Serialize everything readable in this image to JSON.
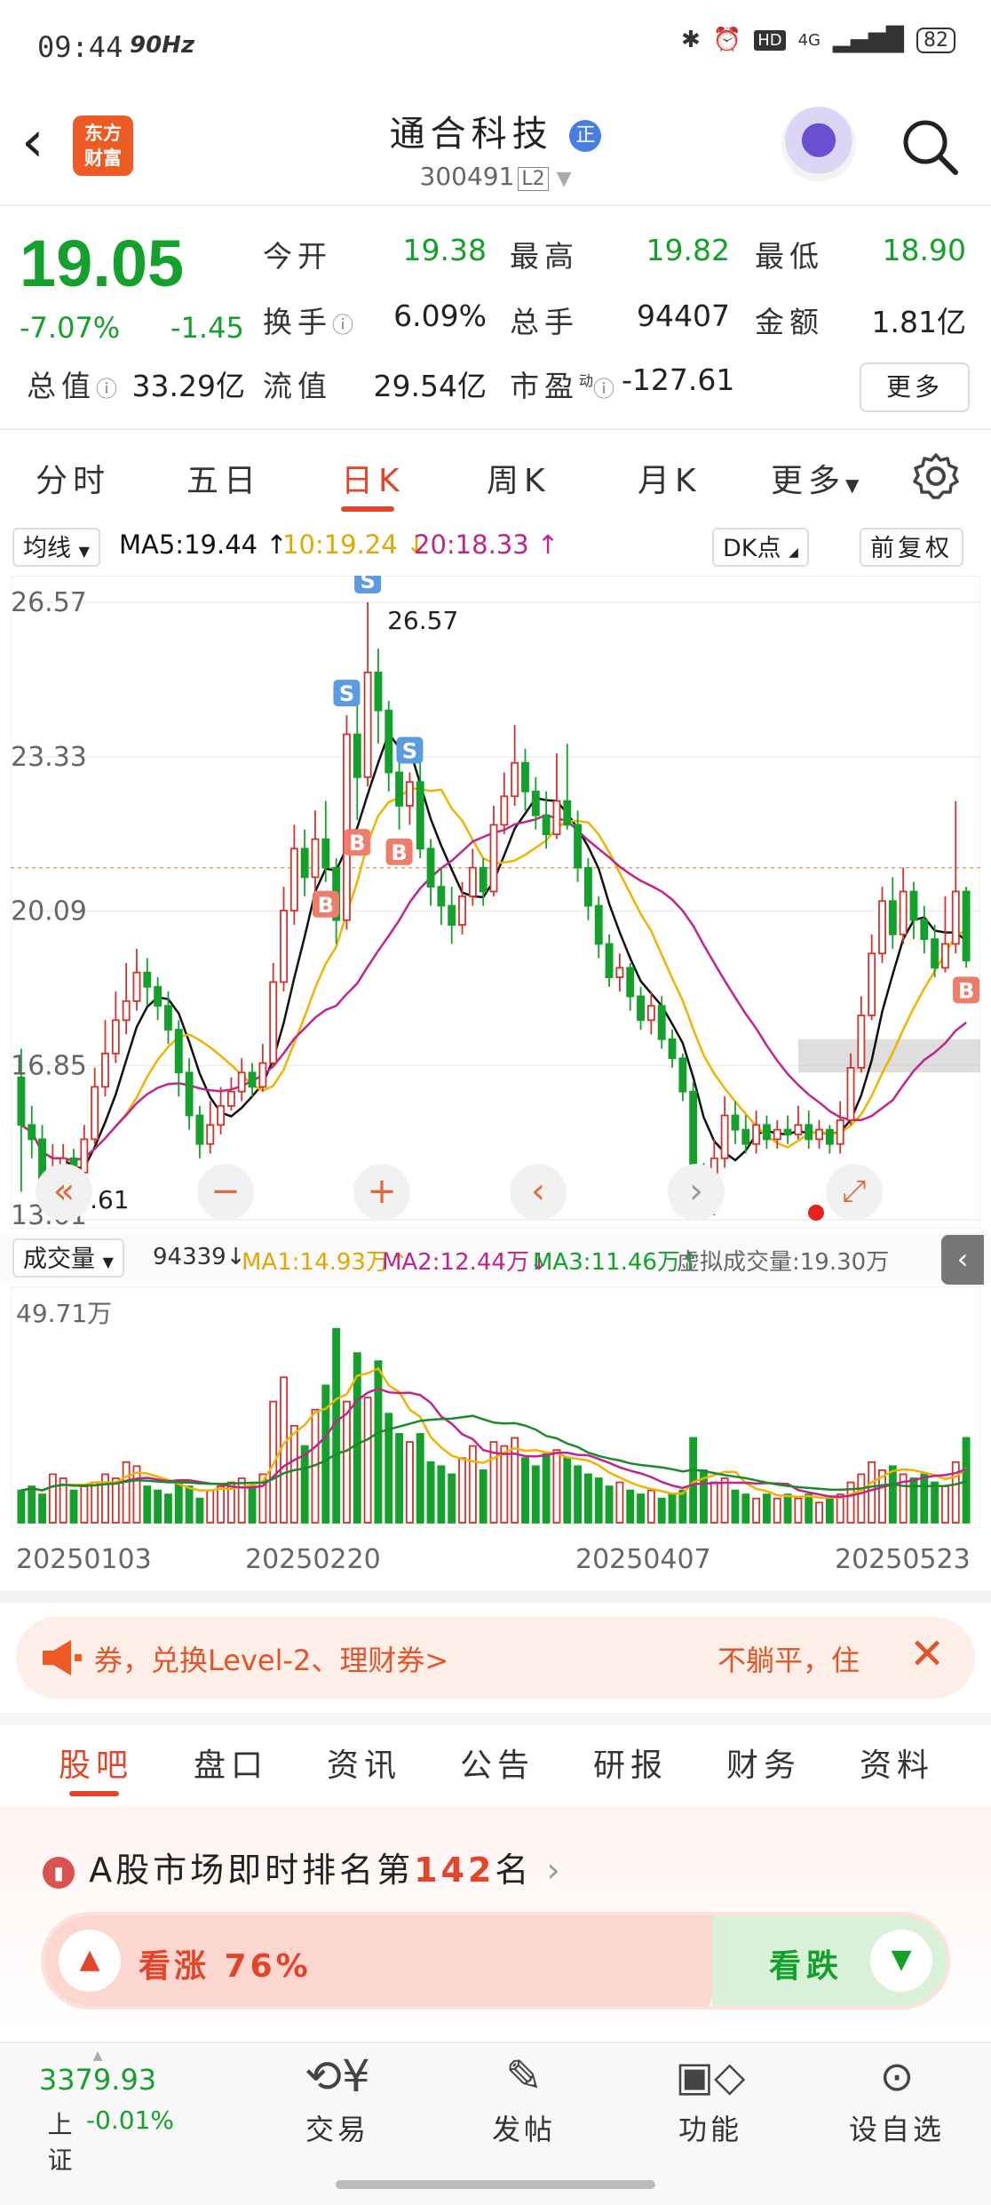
{
  "status_bar": {
    "time": "09:44",
    "refresh": "90Hz",
    "network": "4G",
    "battery": "82"
  },
  "header": {
    "title": "通合科技",
    "badge": "正",
    "code": "300491",
    "level": "L2",
    "logo_text_1": "东方",
    "logo_text_2": "财富"
  },
  "quote": {
    "price": "19.05",
    "change_pct": "-7.07%",
    "change": "-1.45",
    "open_label": "今开",
    "open": "19.38",
    "high_label": "最高",
    "high": "19.82",
    "low_label": "最低",
    "low": "18.90",
    "turnover_label": "换手",
    "turnover": "6.09%",
    "volume_label": "总手",
    "volume": "94407",
    "amount_label": "金额",
    "amount": "1.81亿",
    "mktcap_label": "总值",
    "mktcap": "33.29亿",
    "float_label": "流值",
    "float": "29.54亿",
    "pe_label": "市盈",
    "pe_sup": "动",
    "pe": "-127.61",
    "more": "更多"
  },
  "chart_tabs": [
    "分时",
    "五日",
    "日K",
    "周K",
    "月K",
    "更多"
  ],
  "ma_legend": {
    "selector": "均线",
    "ma5": "MA5:19.44",
    "ma10": "10:19.24",
    "ma20": "20:18.33",
    "dk": "DK点",
    "adjust": "前复权"
  },
  "colors": {
    "up": "#d0342c",
    "down": "#14a12b",
    "ma5": "#111111",
    "ma10": "#f0b400",
    "ma20": "#c0258b",
    "accent": "#e3452a"
  },
  "chart_data": {
    "type": "candlestick",
    "y_ticks": [
      "26.57",
      "23.33",
      "20.09",
      "16.85",
      "13.61"
    ],
    "ylim": [
      13.61,
      26.57
    ],
    "max_label": "26.57",
    "min_label": "13.61",
    "dates": [
      "20250103",
      "20250220",
      "20250407",
      "20250523"
    ],
    "candles": [
      [
        16.6,
        15.6,
        17.2,
        14.2
      ],
      [
        15.6,
        15.3,
        16.0,
        14.9
      ],
      [
        15.3,
        14.2,
        15.6,
        14.0
      ],
      [
        14.2,
        14.5,
        15.2,
        13.8
      ],
      [
        14.5,
        14.9,
        15.2,
        14.3
      ],
      [
        14.9,
        14.6,
        15.1,
        14.4
      ],
      [
        14.6,
        15.3,
        15.6,
        14.5
      ],
      [
        15.3,
        16.4,
        16.8,
        15.2
      ],
      [
        16.4,
        17.1,
        17.8,
        16.2
      ],
      [
        17.1,
        17.8,
        18.4,
        16.9
      ],
      [
        17.8,
        18.2,
        19.0,
        17.5
      ],
      [
        18.2,
        18.8,
        19.3,
        18.0
      ],
      [
        18.8,
        18.5,
        19.1,
        18.1
      ],
      [
        18.5,
        18.1,
        18.7,
        17.8
      ],
      [
        18.1,
        17.6,
        18.4,
        17.3
      ],
      [
        17.6,
        16.7,
        17.8,
        16.2
      ],
      [
        16.7,
        15.8,
        17.0,
        15.5
      ],
      [
        15.8,
        15.2,
        16.0,
        14.9
      ],
      [
        15.2,
        15.6,
        16.1,
        15.0
      ],
      [
        15.6,
        16.0,
        16.4,
        15.4
      ],
      [
        16.0,
        16.3,
        16.6,
        15.9
      ],
      [
        16.3,
        16.7,
        17.0,
        16.1
      ],
      [
        16.7,
        16.4,
        16.9,
        16.2
      ],
      [
        16.4,
        16.9,
        17.3,
        16.3
      ],
      [
        16.9,
        18.6,
        19.0,
        16.8
      ],
      [
        18.6,
        20.1,
        20.6,
        18.4
      ],
      [
        20.1,
        21.4,
        21.9,
        19.8
      ],
      [
        21.4,
        20.8,
        21.8,
        20.4
      ],
      [
        20.8,
        21.6,
        22.2,
        20.5
      ],
      [
        21.6,
        21.0,
        22.4,
        20.7
      ],
      [
        21.0,
        19.9,
        21.2,
        19.4
      ],
      [
        19.9,
        23.8,
        24.2,
        19.7
      ],
      [
        23.8,
        22.9,
        24.8,
        22.0
      ],
      [
        22.9,
        25.1,
        26.57,
        22.7
      ],
      [
        25.1,
        24.3,
        25.6,
        23.6
      ],
      [
        24.3,
        23.0,
        24.5,
        22.6
      ],
      [
        23.0,
        22.3,
        23.3,
        21.8
      ],
      [
        22.3,
        22.8,
        23.0,
        21.9
      ],
      [
        22.8,
        21.4,
        23.3,
        21.2
      ],
      [
        21.4,
        20.6,
        21.6,
        20.2
      ],
      [
        20.6,
        20.2,
        21.0,
        19.8
      ],
      [
        20.2,
        19.8,
        20.6,
        19.4
      ],
      [
        19.8,
        20.4,
        20.7,
        19.6
      ],
      [
        20.4,
        21.0,
        21.4,
        20.2
      ],
      [
        21.0,
        20.5,
        21.2,
        20.2
      ],
      [
        20.5,
        21.9,
        22.3,
        20.4
      ],
      [
        21.9,
        22.5,
        23.0,
        21.7
      ],
      [
        22.5,
        23.2,
        24.0,
        22.3
      ],
      [
        23.2,
        22.6,
        23.5,
        22.2
      ],
      [
        22.6,
        22.1,
        22.9,
        21.8
      ],
      [
        22.1,
        21.7,
        22.6,
        21.4
      ],
      [
        21.7,
        22.4,
        23.4,
        21.6
      ],
      [
        22.4,
        21.9,
        23.6,
        21.8
      ],
      [
        21.9,
        21.0,
        22.2,
        20.7
      ],
      [
        21.0,
        20.2,
        21.2,
        19.9
      ],
      [
        20.2,
        19.4,
        20.4,
        19.1
      ],
      [
        19.4,
        18.7,
        19.6,
        18.5
      ],
      [
        18.7,
        18.9,
        19.2,
        18.4
      ],
      [
        18.9,
        18.3,
        19.0,
        18.0
      ],
      [
        18.3,
        17.8,
        18.5,
        17.6
      ],
      [
        17.8,
        18.1,
        18.4,
        17.5
      ],
      [
        18.1,
        17.4,
        18.3,
        17.2
      ],
      [
        17.4,
        17.0,
        17.6,
        16.8
      ],
      [
        17.0,
        16.3,
        17.1,
        16.1
      ],
      [
        16.3,
        14.2,
        16.5,
        14.0
      ],
      [
        14.2,
        13.9,
        14.8,
        13.61
      ],
      [
        13.9,
        14.9,
        15.3,
        13.7
      ],
      [
        14.9,
        15.8,
        16.2,
        14.7
      ],
      [
        15.8,
        15.5,
        16.1,
        15.2
      ],
      [
        15.5,
        15.2,
        15.8,
        15.0
      ],
      [
        15.2,
        15.6,
        15.9,
        15.0
      ],
      [
        15.6,
        15.3,
        15.8,
        15.1
      ],
      [
        15.3,
        15.5,
        15.7,
        15.1
      ],
      [
        15.5,
        15.4,
        15.8,
        15.2
      ],
      [
        15.4,
        15.6,
        16.0,
        15.3
      ],
      [
        15.6,
        15.3,
        15.9,
        15.1
      ],
      [
        15.3,
        15.5,
        15.7,
        15.1
      ],
      [
        15.5,
        15.2,
        15.6,
        15.0
      ],
      [
        15.2,
        15.7,
        16.1,
        15.0
      ],
      [
        15.7,
        16.8,
        17.1,
        15.6
      ],
      [
        16.8,
        17.9,
        18.3,
        16.7
      ],
      [
        17.9,
        19.2,
        19.6,
        17.8
      ],
      [
        19.2,
        20.3,
        20.6,
        19.0
      ],
      [
        20.3,
        19.6,
        20.8,
        19.3
      ],
      [
        19.6,
        20.5,
        21.0,
        19.4
      ],
      [
        20.5,
        19.9,
        20.7,
        19.5
      ],
      [
        19.9,
        19.5,
        20.2,
        19.2
      ],
      [
        19.5,
        18.9,
        19.8,
        18.7
      ],
      [
        18.9,
        19.4,
        20.4,
        18.8
      ],
      [
        19.4,
        20.5,
        22.4,
        19.2
      ],
      [
        20.5,
        19.05,
        20.6,
        18.9
      ]
    ],
    "buy_sell_marks": [
      "S",
      "S",
      "S",
      "B",
      "B",
      "B",
      "B"
    ],
    "volume": {
      "label": "成交量",
      "current": "94339",
      "max_label": "49.71万",
      "ma1": "MA1:14.93万",
      "ma2": "MA2:12.44万",
      "ma3": "MA3:11.46万",
      "virtual": "虚拟成交量:19.30万",
      "values": [
        8,
        9,
        7,
        12,
        11,
        8,
        9,
        10,
        12,
        11,
        15,
        14,
        9,
        8,
        7,
        10,
        9,
        6,
        8,
        9,
        10,
        11,
        9,
        12,
        30,
        36,
        24,
        19,
        28,
        34,
        48,
        30,
        42,
        31,
        40,
        27,
        22,
        20,
        22,
        15,
        14,
        12,
        16,
        19,
        13,
        20,
        19,
        21,
        16,
        14,
        17,
        18,
        16,
        14,
        12,
        11,
        9,
        10,
        8,
        7,
        8,
        6,
        7,
        8,
        21,
        13,
        10,
        11,
        8,
        7,
        6,
        7,
        6,
        7,
        6,
        7,
        5,
        6,
        7,
        10,
        12,
        15,
        13,
        14,
        12,
        11,
        12,
        10,
        9,
        15,
        21
      ]
    }
  },
  "banner": {
    "left_text": "券，兑换Level-2、理财券>",
    "right_text": "不躺平，住"
  },
  "info_tabs": [
    "股吧",
    "盘口",
    "资讯",
    "公告",
    "研报",
    "财务",
    "资料"
  ],
  "ranking": {
    "prefix": "A股市场即时排名第",
    "rank": "142",
    "suffix": "名",
    "bull": "看涨 76%",
    "bear": "看跌"
  },
  "bottom_nav": {
    "index_value": "3379.93",
    "index_name": "上证",
    "index_change": "-0.01%",
    "trade": "交易",
    "post": "发帖",
    "functions": "功能",
    "watchlist": "设自选"
  }
}
